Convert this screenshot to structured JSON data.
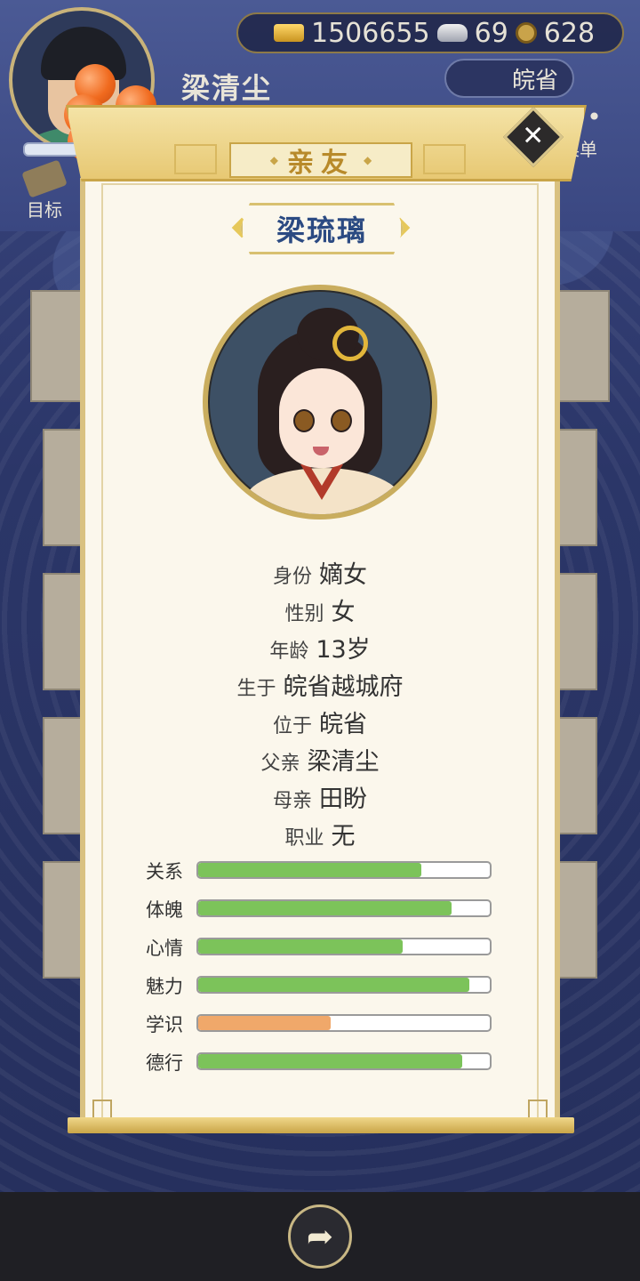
{
  "header": {
    "player_name": "梁清尘",
    "province_label": "皖省",
    "menu_label": "菜单",
    "target_label": "目标",
    "currency": {
      "gold": "1506655",
      "silver": "69",
      "coin": "628"
    }
  },
  "dialog": {
    "title": "亲友",
    "name": "梁琉璃",
    "info": [
      {
        "label": "身份",
        "value": "嫡女"
      },
      {
        "label": "性别",
        "value": "女"
      },
      {
        "label": "年龄",
        "value": "13岁"
      },
      {
        "label": "生于",
        "value": "皖省越城府"
      },
      {
        "label": "位于",
        "value": "皖省"
      },
      {
        "label": "父亲",
        "value": "梁清尘"
      },
      {
        "label": "母亲",
        "value": "田盼"
      },
      {
        "label": "职业",
        "value": "无"
      }
    ],
    "stats": [
      {
        "label": "关系",
        "fraction": 0.765,
        "color": "#7cc35a"
      },
      {
        "label": "体魄",
        "fraction": 0.87,
        "color": "#7cc35a"
      },
      {
        "label": "心情",
        "fraction": 0.7,
        "color": "#7cc35a"
      },
      {
        "label": "魅力",
        "fraction": 0.93,
        "color": "#7cc35a"
      },
      {
        "label": "学识",
        "fraction": 0.455,
        "color": "#f0a86a"
      },
      {
        "label": "德行",
        "fraction": 0.905,
        "color": "#7cc35a"
      }
    ]
  },
  "colors": {
    "accent_gold": "#c9a548",
    "name_blue": "#2b4a82",
    "bar_green": "#7cc35a",
    "bar_orange": "#f0a86a"
  },
  "icons": {
    "close": "close-icon",
    "share": "share-icon",
    "menu": "more-dots-icon",
    "target": "scroll-icon",
    "gold": "gold-ingot-icon",
    "silver": "silver-ingot-icon",
    "coin": "copper-coin-icon"
  }
}
